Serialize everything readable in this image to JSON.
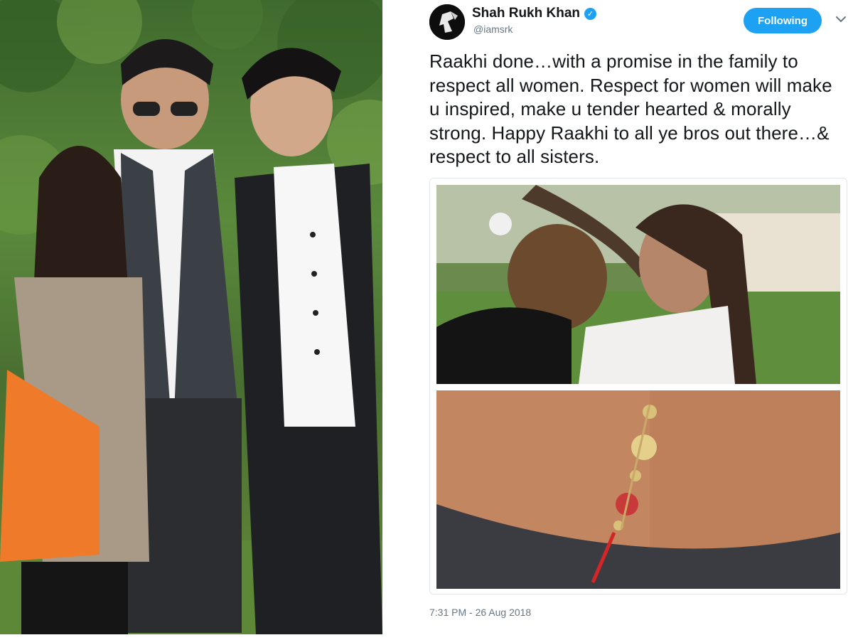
{
  "left_photo": {
    "description_icon": "family-photo"
  },
  "tweet": {
    "display_name": "Shah Rukh Khan",
    "handle": "@iamsrk",
    "verified_icon": "verified-badge-icon",
    "follow_button_label": "Following",
    "menu_icon": "chevron-down-icon",
    "text": "Raakhi done…with a promise in the family to respect all women. Respect for women will make u inspired, make u tender hearted & morally strong. Happy Raakhi to all ye bros out there…& respect to all sisters.",
    "timestamp": "7:31 PM - 26 Aug 2018",
    "media": [
      {
        "icon": "siblings-photo"
      },
      {
        "icon": "rakhi-wrist-photo"
      }
    ]
  },
  "colors": {
    "accent": "#1da1f2",
    "text": "#14171a",
    "muted": "#657786",
    "border": "#e1e8ed"
  }
}
